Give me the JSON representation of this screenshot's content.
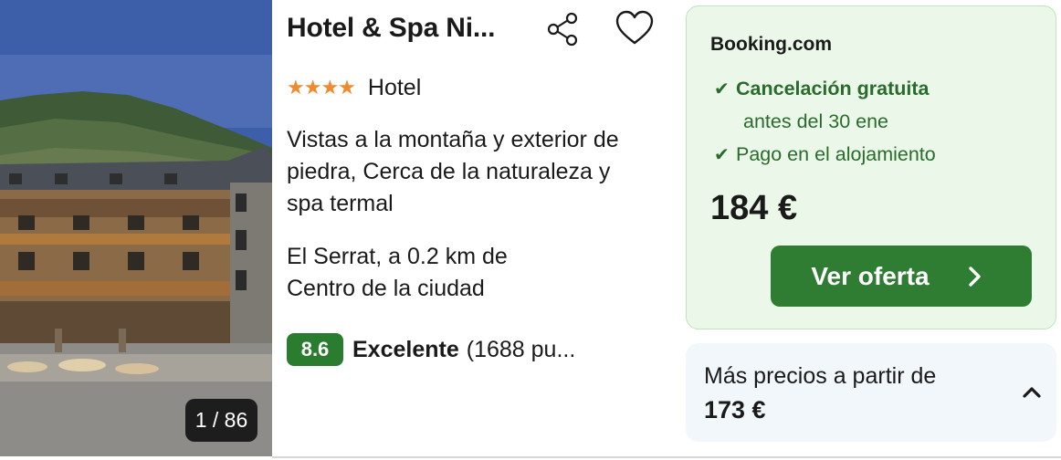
{
  "photo": {
    "counter": "1 / 86"
  },
  "hotel": {
    "title": "Hotel & Spa Ni...",
    "stars": "★★★★",
    "type": "Hotel",
    "description": "Vistas a la montaña y exterior de piedra, Cerca de la naturaleza y spa termal",
    "location_line1": "El Serrat, a 0.2 km de",
    "location_line2": "Centro de la ciudad",
    "rating_score": "8.6",
    "rating_word": "Excelente",
    "rating_count": "(1688 pu..."
  },
  "offer": {
    "provider": "Booking.com",
    "free_cancel": "Cancelación gratuita",
    "free_cancel_until": "antes del 30 ene",
    "pay_at_hotel": "Pago en el alojamiento",
    "price": "184 €",
    "cta_label": "Ver oferta"
  },
  "more_prices": {
    "label": "Más precios a partir de",
    "price": "173 €"
  },
  "icons": {
    "share": "share-icon",
    "favorite": "heart-icon",
    "check": "check-icon",
    "cta_arrow": "chevron-right-icon",
    "expand": "chevron-up-icon"
  },
  "colors": {
    "accent_green": "#2e7d32",
    "offer_bg": "#ebf8e9",
    "star_orange": "#f08a2c",
    "more_bg": "#f2f7fc"
  }
}
